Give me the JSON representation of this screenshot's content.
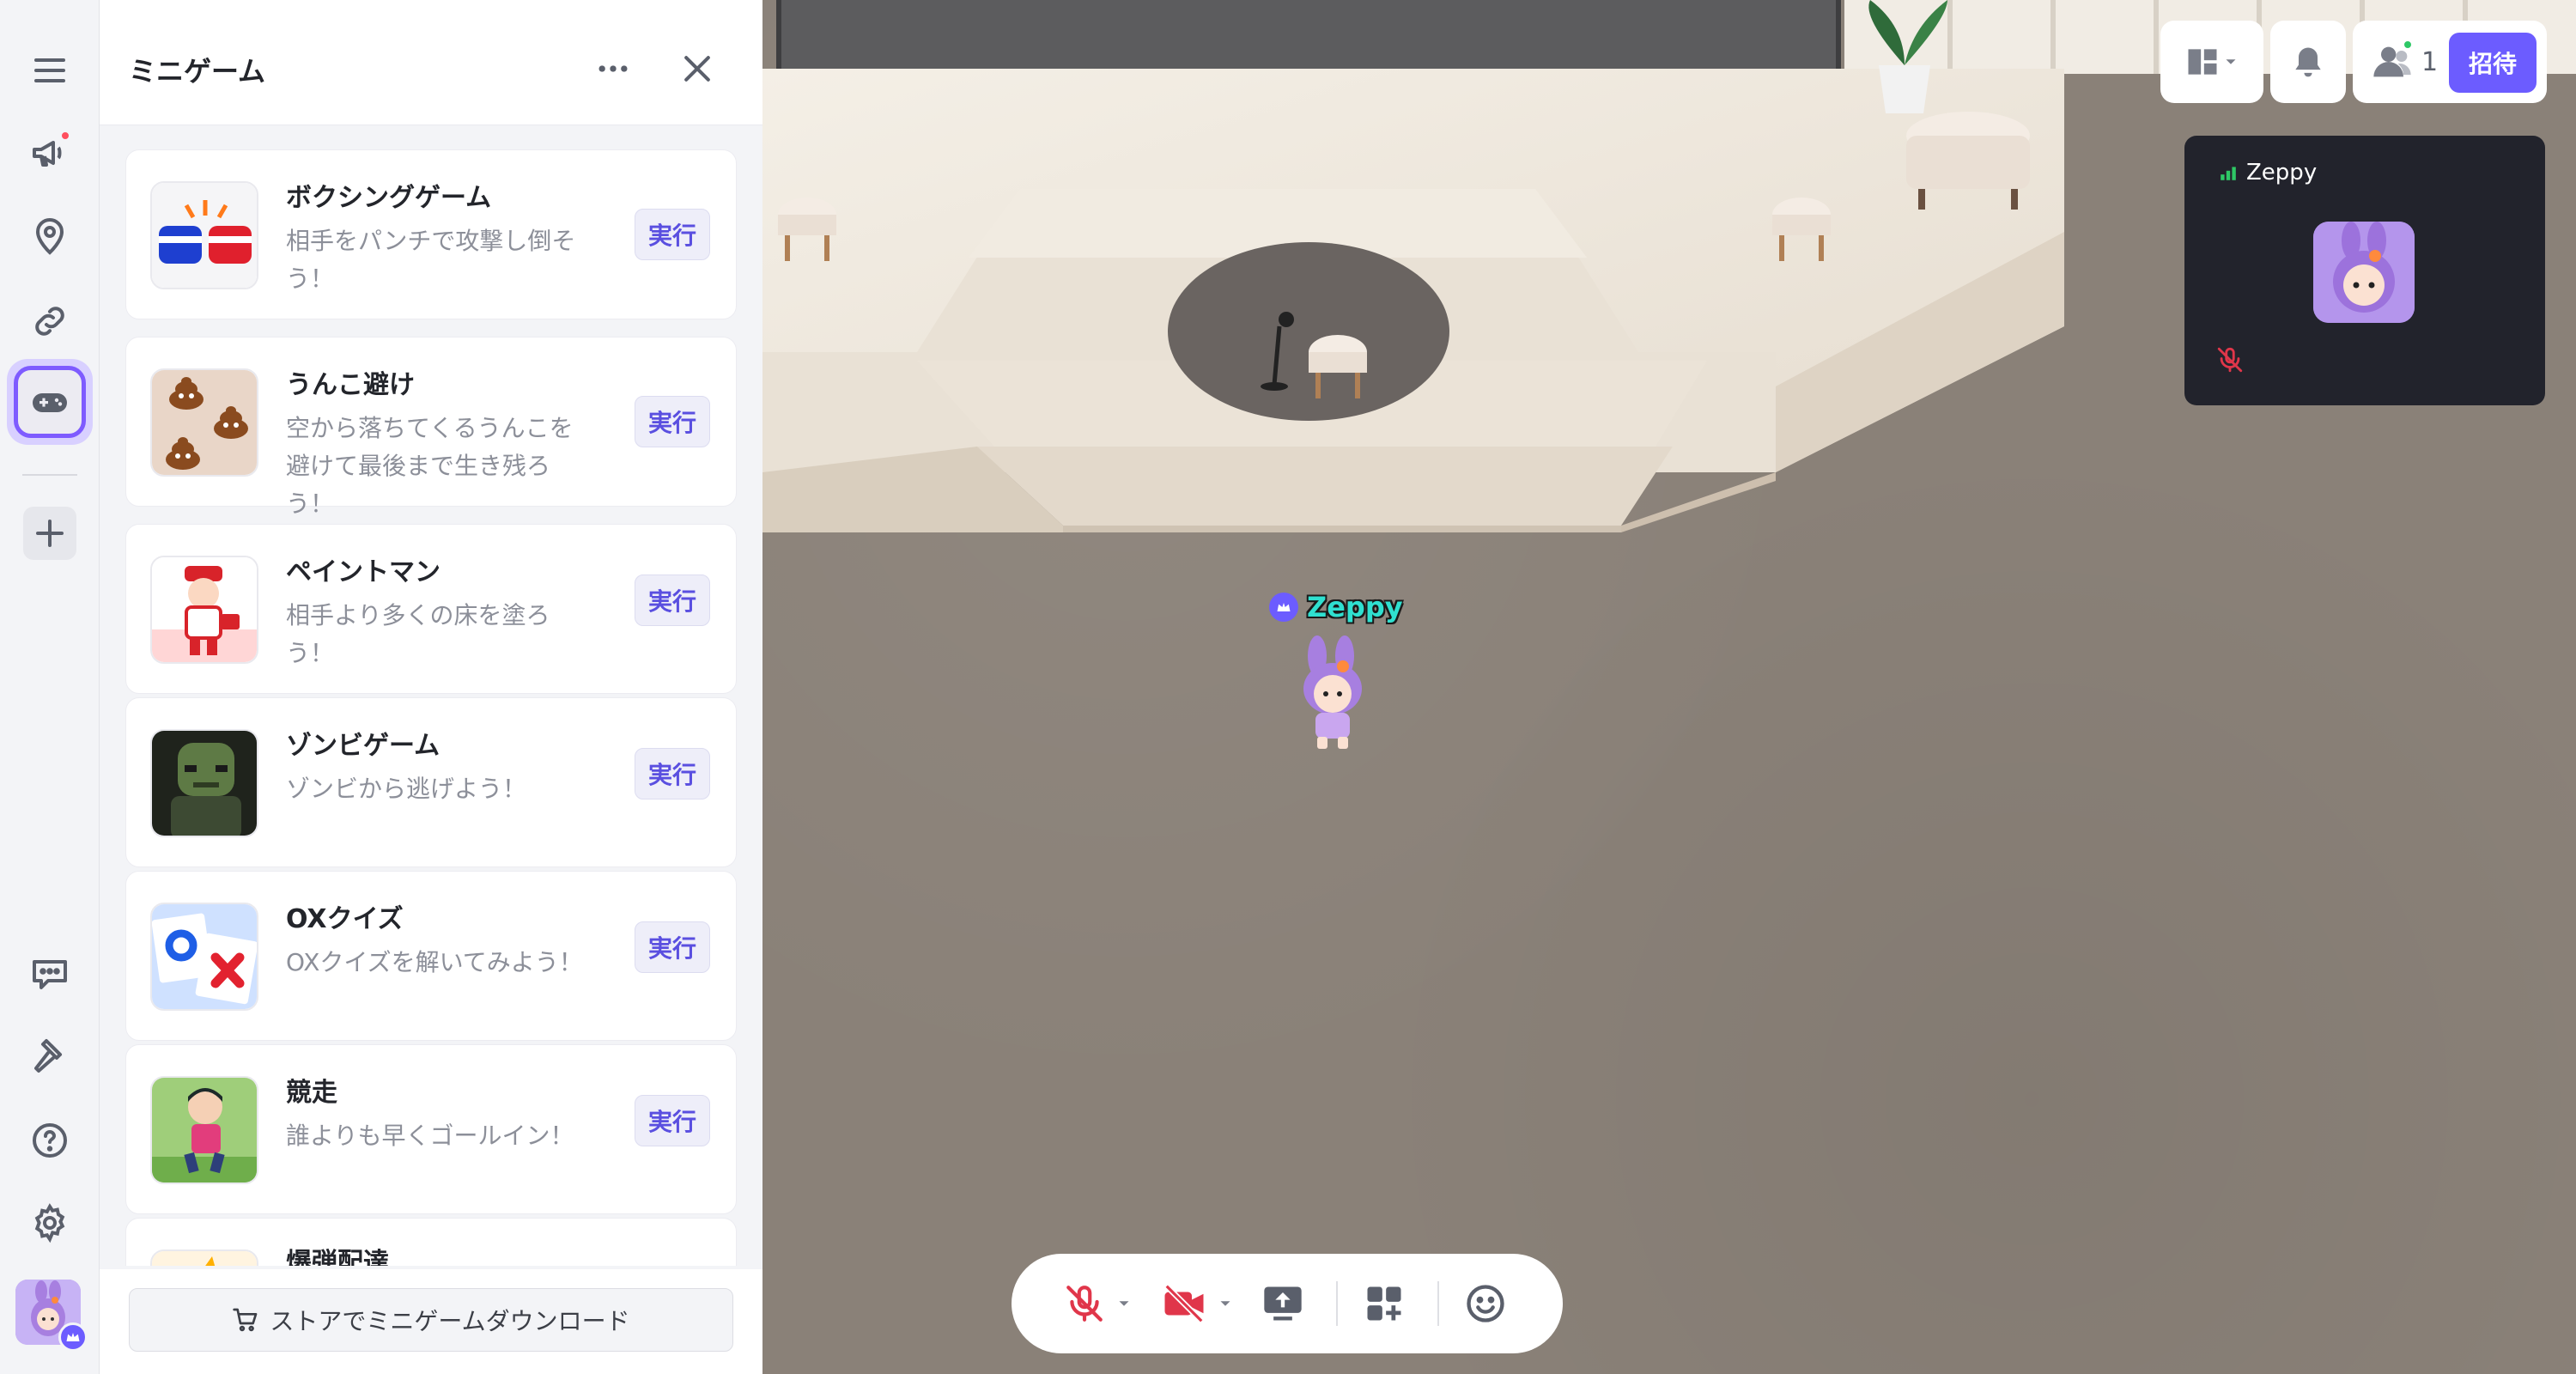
{
  "panel": {
    "title": "ミニゲーム",
    "store_button_label": "ストアでミニゲームダウンロード",
    "run_label": "実行",
    "games": [
      {
        "name": "ボクシングゲーム",
        "desc": "相手をパンチで攻撃し倒そう！"
      },
      {
        "name": "うんこ避け",
        "desc": "空から落ちてくるうんこを避けて最後まで生き残ろう！"
      },
      {
        "name": "ペイントマン",
        "desc": "相手より多くの床を塗ろう！"
      },
      {
        "name": "ゾンビゲーム",
        "desc": "ゾンビから逃げよう！"
      },
      {
        "name": "OXクイズ",
        "desc": "OXクイズを解いてみよう！"
      },
      {
        "name": "競走",
        "desc": "誰よりも早くゴールイン！"
      },
      {
        "name": "爆弾配達",
        "desc": ""
      }
    ]
  },
  "header": {
    "participant_count": "1",
    "invite_label": "招待"
  },
  "video": {
    "user_name": "Zeppy"
  },
  "world": {
    "character_name": "Zeppy"
  },
  "icons": {
    "rail": [
      "menu-icon",
      "megaphone-icon",
      "location-pin-icon",
      "link-icon",
      "gamepad-icon",
      "plus-icon",
      "chat-icon",
      "hammer-icon",
      "help-icon",
      "gear-icon"
    ],
    "toolbar": [
      "mic-off-icon",
      "camera-off-icon",
      "screen-share-icon",
      "apps-add-icon",
      "emoji-icon"
    ]
  },
  "colors": {
    "accent": "#6c5cff",
    "muted_red": "#e0364a",
    "name_tag": "#2fe0d0",
    "online_green": "#2ec866"
  }
}
